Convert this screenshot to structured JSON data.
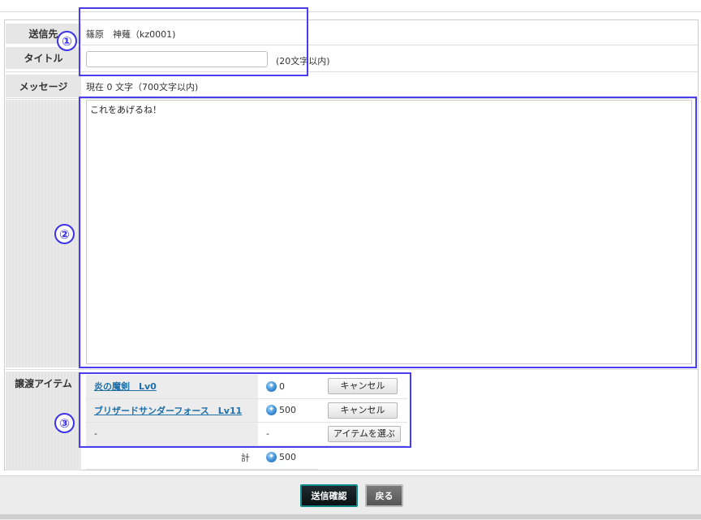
{
  "form": {
    "recipient_label": "送信先",
    "recipient_value": "篠原　神薙（kz0001)",
    "title_label": "タイトル",
    "title_value": "",
    "title_hint": "(20文字以内)",
    "message_label": "メッセージ",
    "message_counter": "現在 0 文字（700文字以内)",
    "message_value": "これをあげるね！",
    "items_label": "譲渡アイテム"
  },
  "items": [
    {
      "name": "炎の魔剣　Lv0",
      "price": "0",
      "action": "キャンセル"
    },
    {
      "name": "ブリザードサンダーフォース　Lv11",
      "price": "500",
      "action": "キャンセル"
    },
    {
      "name": "-",
      "price": "-",
      "action": "アイテムを選ぶ"
    }
  ],
  "total": {
    "label": "計",
    "price": "500"
  },
  "buttons": {
    "confirm": "送信確認",
    "back": "戻る"
  },
  "annotations": {
    "one": "①",
    "two": "②",
    "three": "③"
  },
  "icons": {
    "currency": "gem-icon"
  },
  "colors": {
    "annotation": "#4a3df0",
    "link": "#1f6fa8",
    "confirm_border": "#0f8a86"
  }
}
